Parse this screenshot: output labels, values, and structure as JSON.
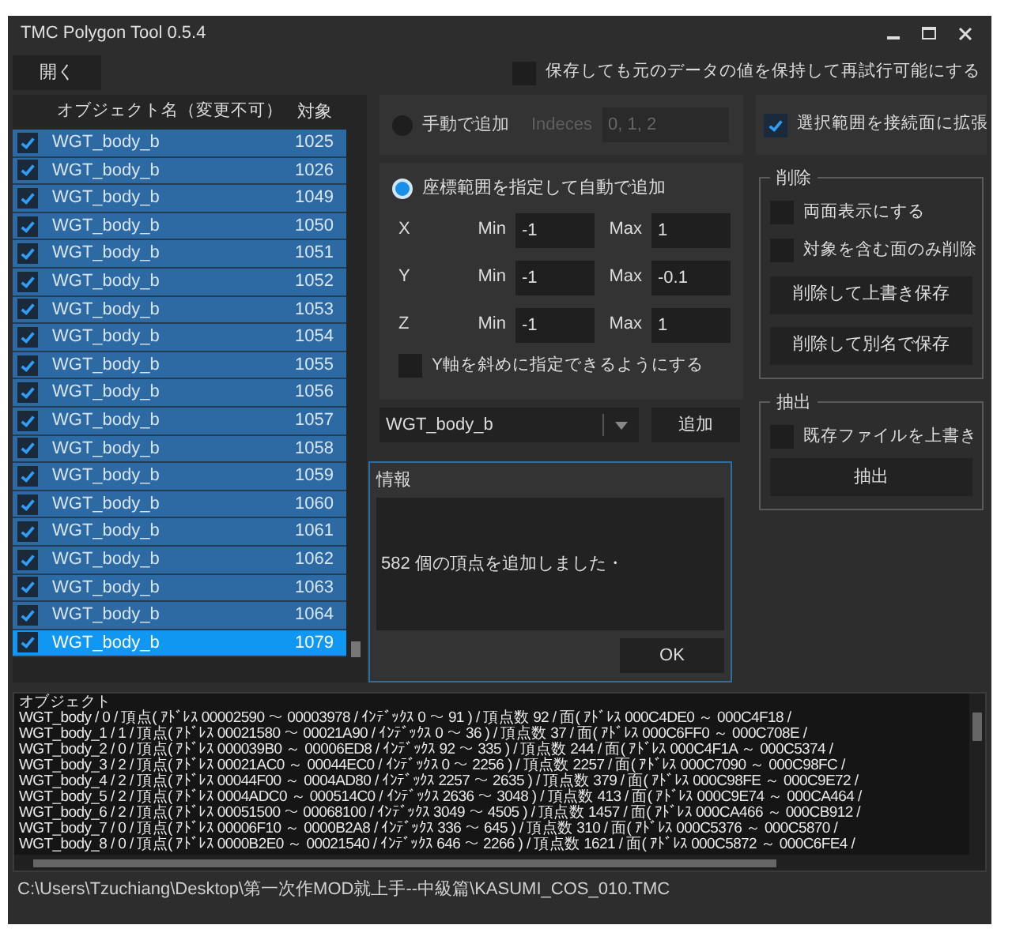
{
  "window": {
    "title": "TMC Polygon Tool 0.5.4"
  },
  "toolbar": {
    "open_button": "開く",
    "keep_checkbox": {
      "label": "保存しても元のデータの値を保持して再試行可能にする",
      "checked": false
    }
  },
  "object_list": {
    "columns": [
      "オブジェクト名（変更不可）",
      "対象"
    ],
    "rows": [
      {
        "name": "WGT_body_b",
        "target": "1025",
        "checked": true,
        "selected": false
      },
      {
        "name": "WGT_body_b",
        "target": "1026",
        "checked": true,
        "selected": false
      },
      {
        "name": "WGT_body_b",
        "target": "1049",
        "checked": true,
        "selected": false
      },
      {
        "name": "WGT_body_b",
        "target": "1050",
        "checked": true,
        "selected": false
      },
      {
        "name": "WGT_body_b",
        "target": "1051",
        "checked": true,
        "selected": false
      },
      {
        "name": "WGT_body_b",
        "target": "1052",
        "checked": true,
        "selected": false
      },
      {
        "name": "WGT_body_b",
        "target": "1053",
        "checked": true,
        "selected": false
      },
      {
        "name": "WGT_body_b",
        "target": "1054",
        "checked": true,
        "selected": false
      },
      {
        "name": "WGT_body_b",
        "target": "1055",
        "checked": true,
        "selected": false
      },
      {
        "name": "WGT_body_b",
        "target": "1056",
        "checked": true,
        "selected": false
      },
      {
        "name": "WGT_body_b",
        "target": "1057",
        "checked": true,
        "selected": false
      },
      {
        "name": "WGT_body_b",
        "target": "1058",
        "checked": true,
        "selected": false
      },
      {
        "name": "WGT_body_b",
        "target": "1059",
        "checked": true,
        "selected": false
      },
      {
        "name": "WGT_body_b",
        "target": "1060",
        "checked": true,
        "selected": false
      },
      {
        "name": "WGT_body_b",
        "target": "1061",
        "checked": true,
        "selected": false
      },
      {
        "name": "WGT_body_b",
        "target": "1062",
        "checked": true,
        "selected": false
      },
      {
        "name": "WGT_body_b",
        "target": "1063",
        "checked": true,
        "selected": false
      },
      {
        "name": "WGT_body_b",
        "target": "1064",
        "checked": true,
        "selected": false
      },
      {
        "name": "WGT_body_b",
        "target": "1079",
        "checked": true,
        "selected": true
      }
    ]
  },
  "manual_add": {
    "label": "手動で追加",
    "selected": false,
    "indices_label": "Indeces",
    "indices_value": "0, 1, 2"
  },
  "auto_add": {
    "label": "座標範囲を指定して自動で追加",
    "selected": true,
    "axes": [
      {
        "axis": "X",
        "min_label": "Min",
        "min": "-1",
        "max_label": "Max",
        "max": "1"
      },
      {
        "axis": "Y",
        "min_label": "Min",
        "min": "-1",
        "max_label": "Max",
        "max": "-0.1"
      },
      {
        "axis": "Z",
        "min_label": "Min",
        "min": "-1",
        "max_label": "Max",
        "max": "1"
      }
    ],
    "diagonal_checkbox": {
      "label": "Y軸を斜めに指定できるようにする",
      "checked": false
    }
  },
  "object_select": {
    "value": "WGT_body_b"
  },
  "add_button": "追加",
  "expand_checkbox": {
    "label": "選択範囲を接続面に拡張",
    "checked": true
  },
  "delete_group": {
    "title": "削除",
    "options": [
      {
        "label": "両面表示にする",
        "checked": false
      },
      {
        "label": "対象を含む面のみ削除",
        "checked": false
      }
    ],
    "buttons": [
      "削除して上書き保存",
      "削除して別名で保存"
    ]
  },
  "extract_group": {
    "title": "抽出",
    "options": [
      {
        "label": "既存ファイルを上書き",
        "checked": false
      }
    ],
    "buttons": [
      "抽出"
    ]
  },
  "dialog": {
    "title": "情報",
    "message": "582 個の頂点を追加しました・",
    "ok_button": "OK"
  },
  "log": {
    "title": "オブジェクト",
    "lines": [
      "WGT_body / 0 / 頂点( ｱﾄﾞﾚｽ 00002590 ～ 00003978 / ｲﾝﾃﾞｯｸｽ 0 ～ 91 ) / 頂点数 92 / 面( ｱﾄﾞﾚｽ 000C4DE0 ～ 000C4F18 /",
      "WGT_body_1 / 1 / 頂点( ｱﾄﾞﾚｽ 00021580 ～ 00021A90 / ｲﾝﾃﾞｯｸｽ 0 ～ 36 ) / 頂点数 37 / 面( ｱﾄﾞﾚｽ 000C6FF0 ～ 000C708E /",
      "WGT_body_2 / 0 / 頂点( ｱﾄﾞﾚｽ 000039B0 ～ 00006ED8 / ｲﾝﾃﾞｯｸｽ 92 ～ 335 ) / 頂点数 244 / 面( ｱﾄﾞﾚｽ 000C4F1A ～ 000C5374 /",
      "WGT_body_3 / 2 / 頂点( ｱﾄﾞﾚｽ 00021AC0 ～ 00044EC0 / ｲﾝﾃﾞｯｸｽ 0 ～ 2256 ) / 頂点数 2257 / 面( ｱﾄﾞﾚｽ 000C7090 ～ 000C98FC /",
      "WGT_body_4 / 2 / 頂点( ｱﾄﾞﾚｽ 00044F00 ～ 0004AD80 / ｲﾝﾃﾞｯｸｽ 2257 ～ 2635 ) / 頂点数 379 / 面( ｱﾄﾞﾚｽ 000C98FE ～ 000C9E72 /",
      "WGT_body_5 / 2 / 頂点( ｱﾄﾞﾚｽ 0004ADC0 ～ 000514C0 / ｲﾝﾃﾞｯｸｽ 2636 ～ 3048 ) / 頂点数 413 / 面( ｱﾄﾞﾚｽ 000C9E74 ～ 000CA464 /",
      "WGT_body_6 / 2 / 頂点( ｱﾄﾞﾚｽ 00051500 ～ 00068100 / ｲﾝﾃﾞｯｸｽ 3049 ～ 4505 ) / 頂点数 1457 / 面( ｱﾄﾞﾚｽ 000CA466 ～ 000CB912 /",
      "WGT_body_7 / 0 / 頂点( ｱﾄﾞﾚｽ 00006F10 ～ 0000B2A8 / ｲﾝﾃﾞｯｸｽ 336 ～ 645 ) / 頂点数 310 / 面( ｱﾄﾞﾚｽ 000C5376 ～ 000C5870 /",
      "WGT_body_8 / 0 / 頂点( ｱﾄﾞﾚｽ 0000B2E0 ～ 00021540 / ｲﾝﾃﾞｯｸｽ 646 ～ 2266 ) / 頂点数 1621 / 面( ｱﾄﾞﾚｽ 000C5872 ～ 000C6FE4 /"
    ]
  },
  "status_path": "C:\\Users\\Tzuchiang\\Desktop\\第一次作MOD就上手--中級篇\\KASUMI_COS_010.TMC"
}
